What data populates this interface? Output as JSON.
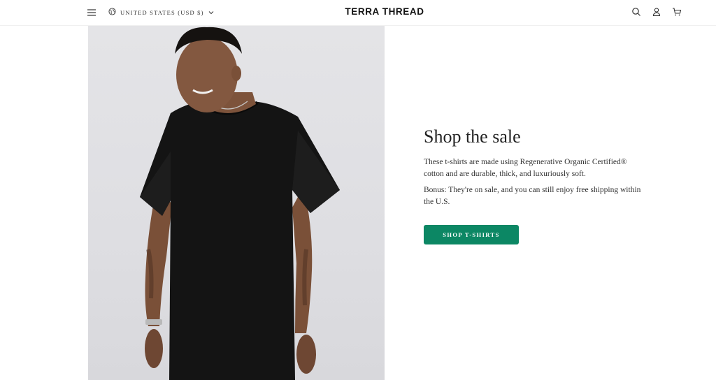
{
  "header": {
    "region_label": "UNITED STATES (USD $)",
    "logo": "TERRA THREAD"
  },
  "icons": {
    "menu": "hamburger-menu-icon",
    "region": "globe-icon",
    "region_chevron": "chevron-down-icon",
    "search": "search-icon",
    "account": "user-icon",
    "cart": "cart-icon"
  },
  "hero": {
    "image": "model-wearing-black-t-shirt-photo",
    "headline": "Shop the sale",
    "paragraph_1": "These t-shirts are made using Regenerative Organic Certified® cotton and are durable, thick, and luxuriously soft.",
    "paragraph_2": "Bonus: They're on sale, and you can still enjoy free shipping within the U.S.",
    "cta_label": "SHOP T-SHIRTS"
  },
  "colors": {
    "accent": "#0c8764",
    "text": "#222222",
    "background": "#ffffff",
    "photo_background": "#e2e2e6"
  }
}
